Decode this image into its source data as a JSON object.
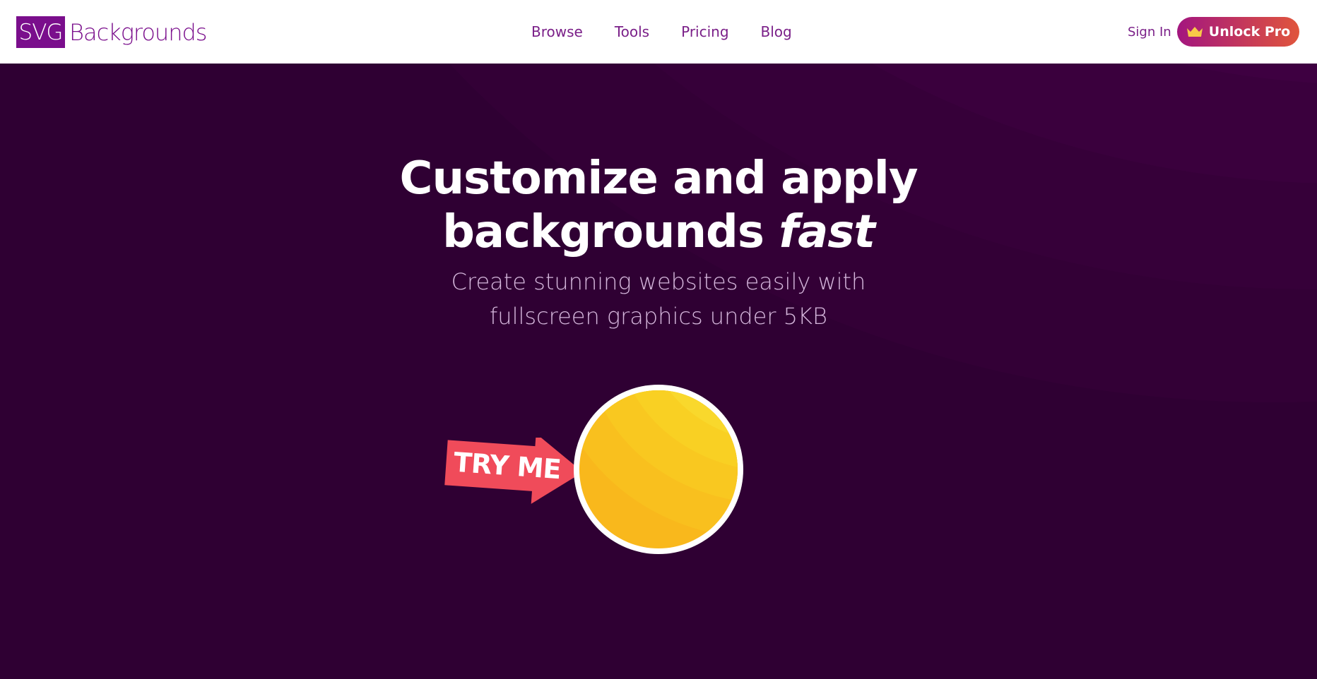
{
  "brand": {
    "logo_box": "SVG",
    "logo_text": "Backgrounds",
    "color": "#7a0e8c"
  },
  "nav": {
    "links": [
      "Browse",
      "Tools",
      "Pricing",
      "Blog"
    ]
  },
  "auth": {
    "signin_label": "Sign In",
    "unlock_label": "Unlock Pro",
    "unlock_icon": "crown-icon"
  },
  "hero": {
    "headline_line1": "Customize and apply",
    "headline_line2_plain": "backgrounds ",
    "headline_line2_italic": "fast",
    "sub_line1": "Create stunning websites easily with",
    "sub_line2": "fullscreen graphics under 5KB",
    "try_label": "TRY ME",
    "background_color": "#2f0033",
    "accent_yellow": "#f9d423",
    "sticker_color": "#f04b5a"
  }
}
